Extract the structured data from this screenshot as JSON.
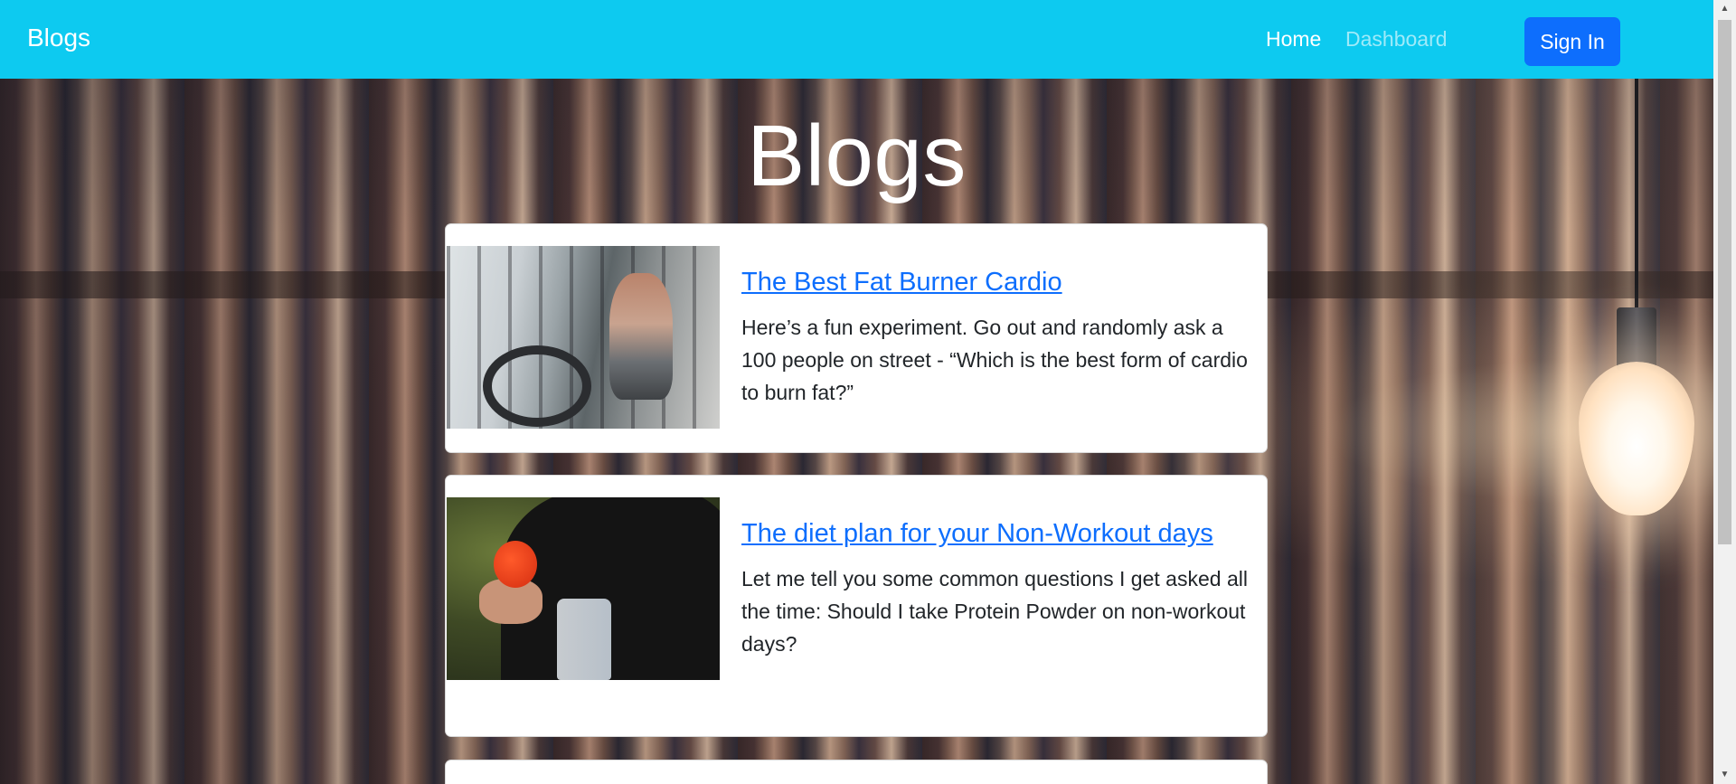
{
  "navbar": {
    "brand": "Blogs",
    "links": [
      {
        "label": "Home",
        "active": true
      },
      {
        "label": "Dashboard",
        "active": false
      }
    ],
    "signin_label": "Sign In",
    "background_color": "#0dcaf0",
    "button_color": "#0d6efd"
  },
  "page": {
    "title": "Blogs",
    "background": "library-bookshelf-photo"
  },
  "posts": [
    {
      "title": "The Best Fat Burner Cardio",
      "excerpt": "Here’s a fun experiment. Go out and randomly ask a 100 people on street - “Which is the best form of cardio to burn fat?”",
      "image": "gym-cardio-photo"
    },
    {
      "title": "The diet plan for your Non-Workout days",
      "excerpt": "Let me tell you some common questions I get asked all the time: Should I take Protein Powder on non-workout days?",
      "image": "protein-shaker-photo"
    }
  ],
  "scrollbar": {
    "up_arrow": "▲",
    "down_arrow": "▼"
  }
}
